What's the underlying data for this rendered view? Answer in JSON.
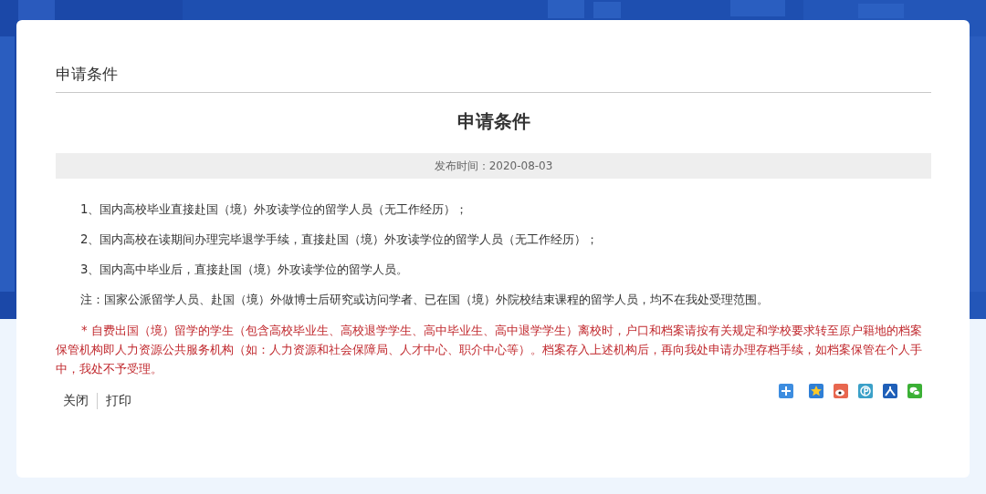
{
  "breadcrumb": "申请条件",
  "article": {
    "title": "申请条件",
    "publish_time": "发布时间：2020-08-03",
    "paragraphs": [
      {
        "kind": "normal",
        "text": "1、国内高校毕业直接赴国（境）外攻读学位的留学人员（无工作经历）；"
      },
      {
        "kind": "normal",
        "text": "2、国内高校在读期间办理完毕退学手续，直接赴国（境）外攻读学位的留学人员（无工作经历）；"
      },
      {
        "kind": "normal",
        "text": "3、国内高中毕业后，直接赴国（境）外攻读学位的留学人员。"
      },
      {
        "kind": "normal",
        "text": "注：国家公派留学人员、赴国（境）外做博士后研究或访问学者、已在国（境）外院校结束课程的留学人员，均不在我处受理范围。"
      },
      {
        "kind": "warning",
        "text": "* 自费出国（境）留学的学生（包含高校毕业生、高校退学学生、高中毕业生、高中退学学生）离校时，户口和档案请按有关规定和学校要求转至原户籍地的档案保管机构即人力资源公共服务机构（如：人力资源和社会保障局、人才中心、职介中心等）。档案存入上述机构后，再向我处申请办理存档手续，如档案保管在个人手中，我处不予受理。"
      }
    ]
  },
  "actions": [
    "关闭",
    "打印"
  ]
}
